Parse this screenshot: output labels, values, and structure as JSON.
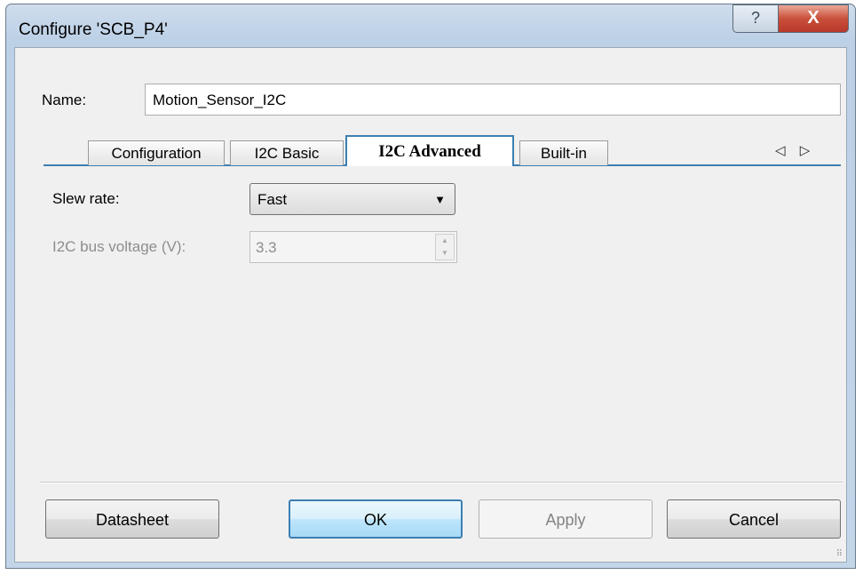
{
  "window": {
    "title": "Configure 'SCB_P4'",
    "help_symbol": "?",
    "close_symbol": "X"
  },
  "name": {
    "label": "Name:",
    "value": "Motion_Sensor_I2C"
  },
  "tabs": [
    {
      "label": "Configuration",
      "active": false
    },
    {
      "label": "I2C Basic",
      "active": false
    },
    {
      "label": "I2C Advanced",
      "active": true
    },
    {
      "label": "Built-in",
      "active": false
    }
  ],
  "tab_scroll": "◁ ▷",
  "fields": {
    "slew_rate": {
      "label": "Slew rate:",
      "value": "Fast"
    },
    "bus_voltage": {
      "label": "I2C bus voltage (V):",
      "value": "3.3",
      "enabled": false
    }
  },
  "buttons": {
    "datasheet": "Datasheet",
    "ok": "OK",
    "apply": "Apply",
    "cancel": "Cancel"
  },
  "colors": {
    "accent": "#3c7fb1",
    "close": "#c9503a",
    "dialog_bg": "#f0f0f0"
  }
}
